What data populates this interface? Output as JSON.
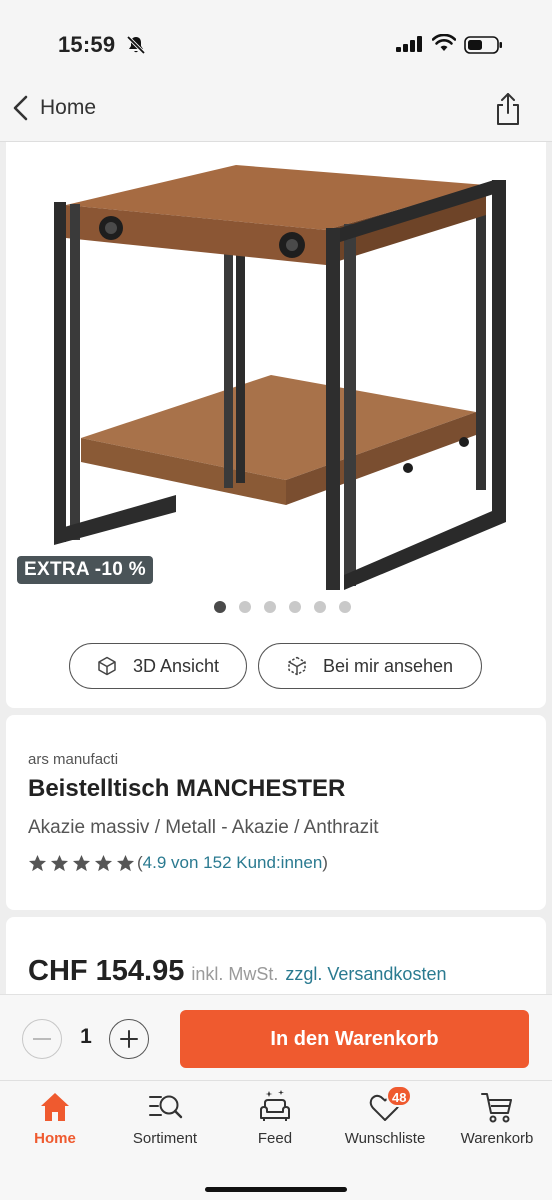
{
  "status_bar": {
    "time": "15:59",
    "icons": [
      "bell-slash-icon",
      "signal-icon",
      "wifi-icon",
      "battery-icon"
    ]
  },
  "nav": {
    "back_label": "Home",
    "back_icon": "chevron-left-icon",
    "share_icon": "share-icon"
  },
  "gallery": {
    "promo_badge": "EXTRA -10 %",
    "image_count": 6,
    "active_index": 0,
    "buttons": [
      {
        "label": "3D Ansicht",
        "icon": "cube-icon"
      },
      {
        "label": "Bei mir ansehen",
        "icon": "ar-cube-icon"
      }
    ]
  },
  "product": {
    "brand": "ars manufacti",
    "title": "Beistelltisch MANCHESTER",
    "subtitle": "Akazie massiv / Metall - Akazie / Anthrazit",
    "rating_value": 4.9,
    "rating_stars": 5,
    "rating_text": "4.9 von 152 Kund:innen"
  },
  "pricing": {
    "price": "CHF 154.95",
    "tax_note": "inkl. MwSt.",
    "shipping_link": "zzgl. Versandkosten"
  },
  "cart": {
    "quantity": "1",
    "add_to_cart_label": "In den Warenkorb"
  },
  "tabs": [
    {
      "label": "Home",
      "icon": "home-icon",
      "active": true
    },
    {
      "label": "Sortiment",
      "icon": "search-list-icon",
      "active": false
    },
    {
      "label": "Feed",
      "icon": "sofa-sparkle-icon",
      "active": false
    },
    {
      "label": "Wunschliste",
      "icon": "heart-icon",
      "badge": "48",
      "active": false
    },
    {
      "label": "Warenkorb",
      "icon": "cart-icon",
      "active": false
    }
  ],
  "colors": {
    "accent": "#ef5a2f",
    "link": "#2a7a90",
    "badge_bg": "#4a5458",
    "text": "#222222"
  }
}
